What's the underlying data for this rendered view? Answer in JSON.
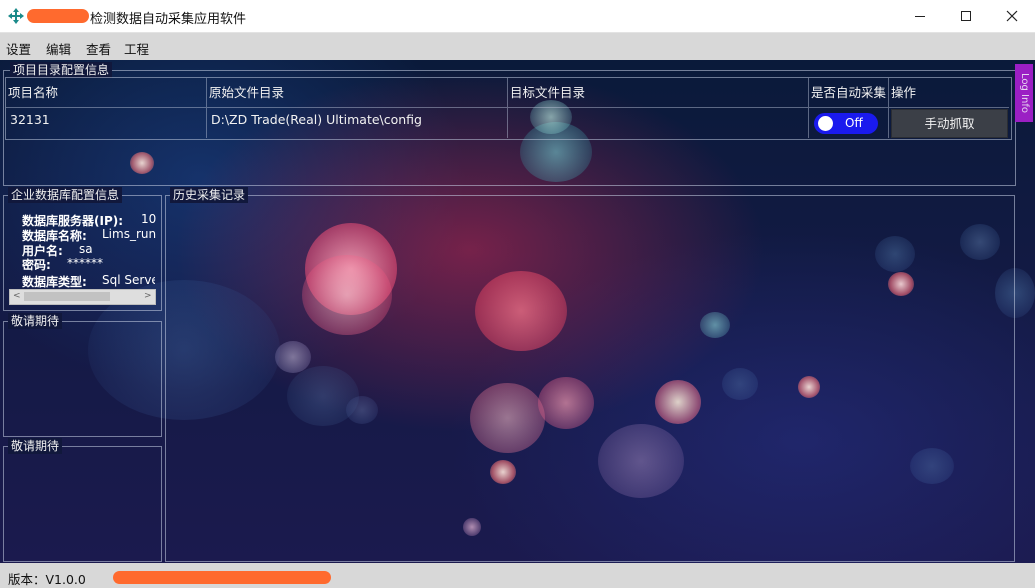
{
  "window": {
    "title": "检测数据自动采集应用软件",
    "icon": "move-arrows-icon",
    "controls": {
      "minimize": "—",
      "maximize": "☐",
      "close": "✕"
    }
  },
  "menu": [
    "设置",
    "编辑",
    "查看",
    "工程"
  ],
  "project_group": {
    "title": "项目目录配置信息",
    "columns": [
      "项目名称",
      "原始文件目录",
      "目标文件目录",
      "是否自动采集",
      "操作"
    ],
    "rows": [
      {
        "name": "32131",
        "source_dir": "D:\\ZD Trade(Real) Ultimate\\config",
        "target_dir": "",
        "auto_label": "Off",
        "action": "手动抓取"
      }
    ]
  },
  "side_tab": "Log Info",
  "db_group": {
    "title": "企业数据库配置信息",
    "fields": [
      {
        "key": "数据库服务器(IP):",
        "value": "10"
      },
      {
        "key": "数据库名称:",
        "value": "Lims_run"
      },
      {
        "key": "用户名:",
        "value": "sa"
      },
      {
        "key": "密码:",
        "value": "******"
      },
      {
        "key": "数据库类型:",
        "value": "Sql Serve"
      }
    ]
  },
  "history_group": {
    "title": "历史采集记录"
  },
  "placeholder_groups": [
    {
      "title": "敬请期待"
    },
    {
      "title": "敬请期待"
    }
  ],
  "status": {
    "version": "版本：V1.0.0"
  },
  "colors": {
    "toggle_blue": "#1a1aee",
    "side_tab_purple": "#9b1fc4",
    "redaction_orange": "#ff6a2e"
  }
}
